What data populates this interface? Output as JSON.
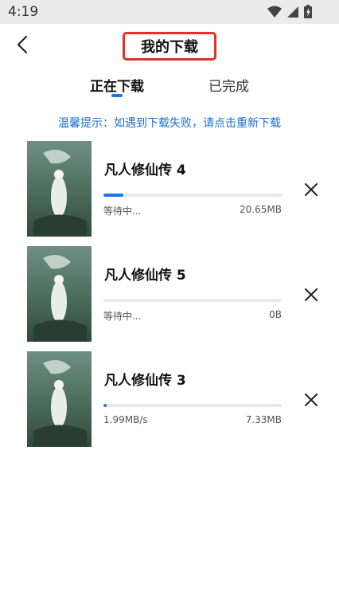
{
  "status_bar": {
    "time": "4:19"
  },
  "header": {
    "title": "我的下载"
  },
  "tabs": [
    {
      "label": "正在下载",
      "active": true
    },
    {
      "label": "已完成",
      "active": false
    }
  ],
  "tip": "温馨提示：如遇到下载失败，请点击重新下载",
  "downloads": [
    {
      "title": "凡人修仙传 4",
      "status": "等待中...",
      "size": "20.65MB",
      "progress": 0.11
    },
    {
      "title": "凡人修仙传 5",
      "status": "等待中...",
      "size": "0B",
      "progress": 0.0
    },
    {
      "title": "凡人修仙传 3",
      "status": "1.99MB/s",
      "size": "7.33MB",
      "progress": 0.02
    }
  ],
  "colors": {
    "accent": "#1a73e8",
    "highlight": "#e0302a",
    "tip": "#1a6fd6"
  }
}
